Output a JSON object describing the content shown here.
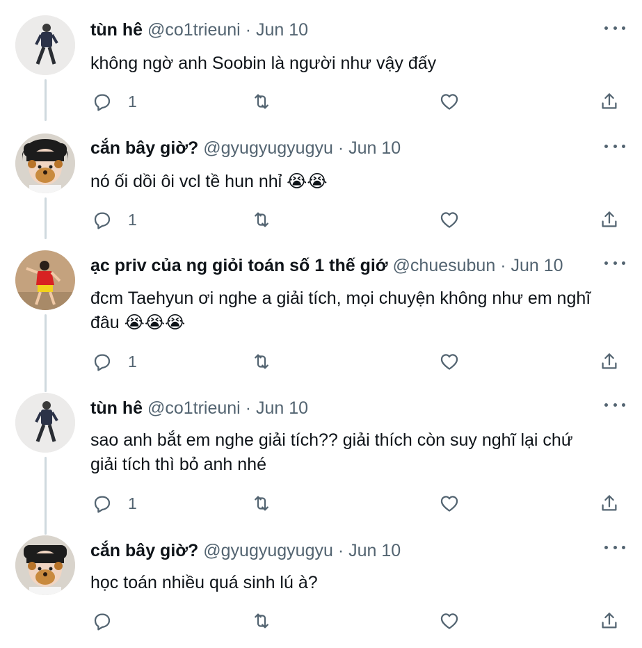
{
  "colors": {
    "text": "#0f1419",
    "secondary": "#536471",
    "thread_line": "#cfd9de"
  },
  "tweets": [
    {
      "name": "tùn hê",
      "handle": "@co1trieuni",
      "separator": "·",
      "date": "Jun 10",
      "text": "không ngờ anh Soobin là người như vậy đấy",
      "reply_count": "1"
    },
    {
      "name": "cắn bây giờ?",
      "handle": "@gyugyugyugyu",
      "separator": "·",
      "date": "Jun 10",
      "text": "nó ối dồi ôi vcl tề hun nhỉ 😭😭",
      "reply_count": "1"
    },
    {
      "name": "ạc priv của ng giỏi toán số 1 thế giớ",
      "handle": "@chuesubun",
      "separator": "·",
      "date": "Jun 10",
      "text": "đcm Taehyun ơi nghe a giải tích, mọi chuyện không như em nghĩ\nđâu 😭😭😭",
      "reply_count": "1"
    },
    {
      "name": "tùn hê",
      "handle": "@co1trieuni",
      "separator": "·",
      "date": "Jun 10",
      "text": "sao anh bắt em nghe giải tích?? giải thích còn suy nghĩ lại chứ\ngiải tích thì bỏ anh nhé",
      "reply_count": "1"
    },
    {
      "name": "cắn bây giờ?",
      "handle": "@gyugyugyugyu",
      "separator": "·",
      "date": "Jun 10",
      "text": "học toán nhiều quá sinh lú à?",
      "reply_count": ""
    }
  ],
  "icons": {
    "reply": "reply-icon",
    "retweet": "retweet-icon",
    "like": "heart-icon",
    "share": "share-icon",
    "more": "more-icon"
  }
}
